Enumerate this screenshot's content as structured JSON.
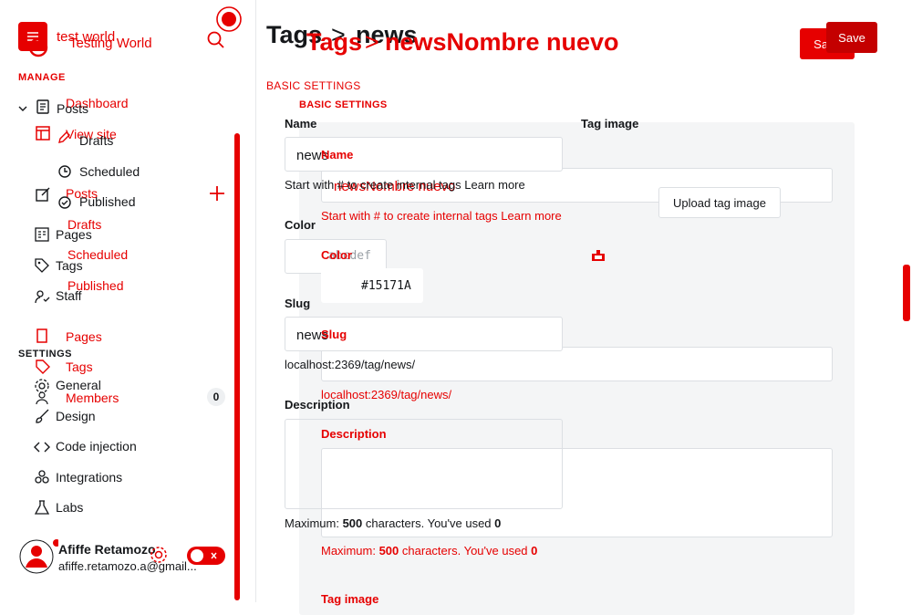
{
  "site": {
    "title": "test world",
    "title_overlay": "Testing World"
  },
  "sidebar": {
    "manage_label": "MANAGE",
    "settings_label": "SETTINGS",
    "ghost_items": {
      "dashboard": "Dashboard",
      "view_site": "View site",
      "posts": "Posts",
      "drafts": "Drafts",
      "scheduled": "Scheduled",
      "published": "Published",
      "pages": "Pages",
      "tags": "Tags",
      "members": "Members",
      "members_count": "0"
    },
    "items": {
      "posts": "Posts",
      "drafts": "Drafts",
      "scheduled": "Scheduled",
      "published": "Published",
      "pages": "Pages",
      "tags": "Tags",
      "staff": "Staff",
      "general": "General",
      "design": "Design",
      "code_injection": "Code injection",
      "integrations": "Integrations",
      "labs": "Labs"
    },
    "user": {
      "name": "Afiffe Retamozo",
      "email": "afiffe.retamozo.a@gmail..."
    }
  },
  "header": {
    "breadcrumb_root": "Tags",
    "breadcrumb_sep": ">",
    "breadcrumb_current": "news",
    "overlay_root": "Tags",
    "overlay_sep": ">",
    "overlay_current": "newsNombre nuevo",
    "save_label": "Save",
    "save_overlay_label": "Save"
  },
  "form": {
    "section_title": "BASIC SETTINGS",
    "name_label": "Name",
    "name_value": "news",
    "name_hint": "Start with # to create internal tags Learn more",
    "color_label": "Color",
    "color_placeholder": "abcdef",
    "slug_label": "Slug",
    "slug_value": "news",
    "slug_url": "localhost:2369/tag/news/",
    "description_label": "Description",
    "description_hint_prefix": "Maximum:",
    "description_max": "500",
    "description_hint_mid": "characters. You've used",
    "description_used": "0",
    "tag_image_label": "Tag image"
  },
  "overlay_form": {
    "section_title": "BASIC SETTINGS",
    "name_label": "Name",
    "name_value": "newsNombre nuevo",
    "name_hint": "Start with # to create internal tags Learn more",
    "color_label": "Color",
    "color_value": "#15171A",
    "slug_label": "Slug",
    "slug_url": "localhost:2369/tag/news/",
    "description_label": "Description",
    "description_hint_prefix": "Maximum:",
    "description_max": "500",
    "description_hint_mid": "characters. You've used",
    "description_used": "0",
    "tag_image_label": "Tag image",
    "upload_label": "Upload tag image"
  },
  "colors": {
    "accent": "#e60000",
    "text": "#15171a",
    "panel": "#f4f5f6"
  },
  "icons": [
    "menu-icon",
    "search-icon",
    "plus-icon",
    "gear-icon",
    "toggle-icon",
    "avatar-icon",
    "trash-icon",
    "chevron-down-icon"
  ]
}
